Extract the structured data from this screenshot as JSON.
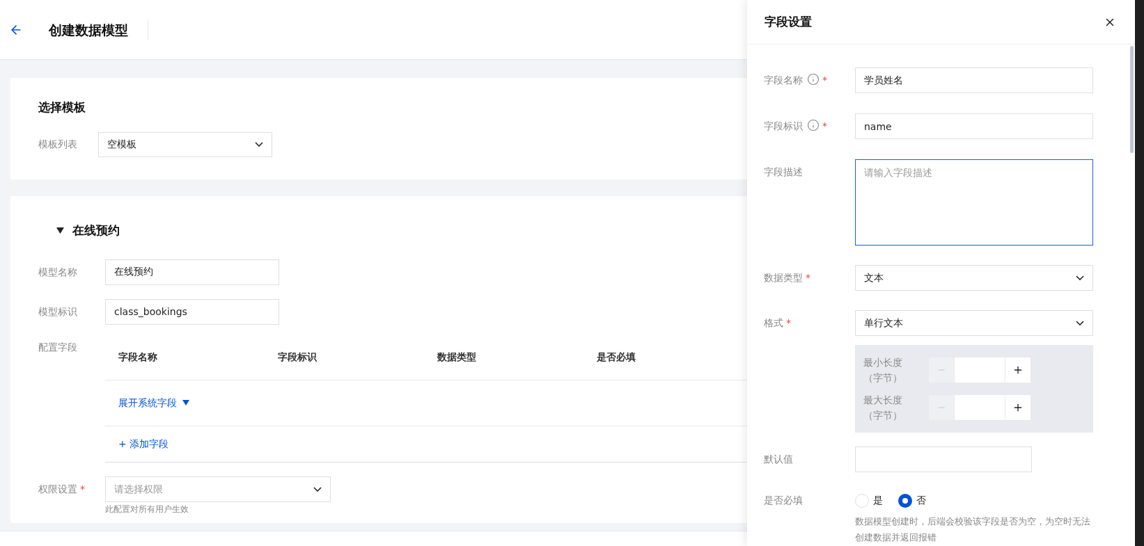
{
  "header": {
    "title": "创建数据模型"
  },
  "template_card": {
    "title": "选择模板",
    "label": "模板列表",
    "value": "空模板"
  },
  "model_card": {
    "title": "在线预约",
    "expanded": true,
    "fields": [
      {
        "label": "模型名称",
        "value": "在线预约"
      },
      {
        "label": "模型标识",
        "value": "class_bookings"
      }
    ],
    "config": {
      "label": "配置字段",
      "columns": [
        "字段名称",
        "字段标识",
        "数据类型",
        "是否必填"
      ],
      "expand_link": "展开系统字段",
      "add_link": "+ 添加字段"
    },
    "permission": {
      "label": "权限设置",
      "required_mark": "*",
      "placeholder": "请选择权限",
      "note": "此配置对所有用户生效"
    }
  },
  "drawer": {
    "title": "字段设置",
    "fields": [
      {
        "kind": "input",
        "label": "字段名称",
        "info": true,
        "required_mark": "*",
        "value": "学员姓名"
      },
      {
        "kind": "input",
        "label": "字段标识",
        "info": true,
        "required_mark": "*",
        "value": "name"
      },
      {
        "kind": "textarea",
        "label": "字段描述",
        "placeholder": "请输入字段描述",
        "focused": true
      },
      {
        "kind": "select",
        "label": "数据类型",
        "required_mark": "*",
        "value": "文本"
      },
      {
        "kind": "select",
        "label": "格式",
        "required_mark": "*",
        "value": "单行文本"
      },
      {
        "kind": "length",
        "rows": [
          {
            "label": "最小长度",
            "unit": "（字节）",
            "minus_disabled": true
          },
          {
            "label": "最大长度",
            "unit": "（字节）",
            "minus_disabled": true
          }
        ]
      },
      {
        "kind": "short_input",
        "label": "默认值"
      },
      {
        "kind": "radio",
        "label": "是否必填",
        "options": [
          {
            "label": "是",
            "selected": false
          },
          {
            "label": "否",
            "selected": true
          }
        ],
        "hint": "数据模型创建时，后端会校验该字段是否为空，为空时无法创建数据并返回报错"
      }
    ]
  }
}
